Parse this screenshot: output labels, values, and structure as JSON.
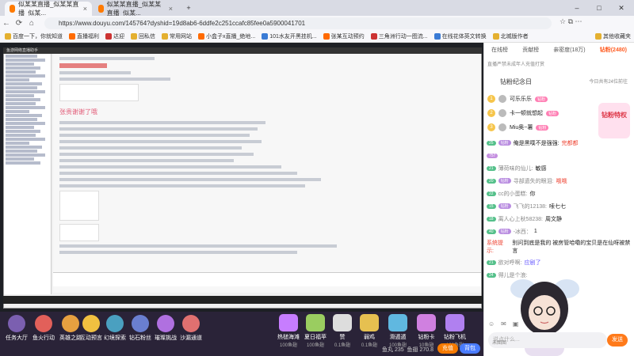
{
  "browser": {
    "tabs": [
      {
        "title": "似某某直播_似某某直播_似某..."
      },
      {
        "title": "似某某直播_似某某直播_似某..."
      }
    ],
    "url": "https://www.douyu.com/145764?dyshid=19d8ab6-6ddfe2c251ccafc85fee0a5900041701",
    "bookmarks": [
      "百度一下，你就知道",
      "直播福利",
      "达迎",
      "回私信",
      "常用网站",
      "小盒子x直播_绝地...",
      "101水友开黑挂机...",
      "张某互动预约",
      "三角洲行动一图流...",
      "在线花体英文转换",
      "北城版作者",
      "其他收藏夹"
    ]
  },
  "video": {
    "doc_heading": "张贵谢谢了哦",
    "screen_title": "鱼游网络直播助手"
  },
  "bottom_bar": {
    "nav_items": [
      "任务大厅",
      "鱼火行动",
      "英雄之路",
      "互动预言",
      "幻境探索",
      "钻石粉丝",
      "璀璨挑战",
      "沙漏通道"
    ],
    "gifts": [
      {
        "name": "热槌海滩",
        "price": "100鱼翅"
      },
      {
        "name": "夏日福苹",
        "price": "100鱼翅"
      },
      {
        "name": "赞",
        "price": "0.1鱼翅"
      },
      {
        "name": "弱鸡",
        "price": "0.1鱼翅"
      },
      {
        "name": "滑遁遁",
        "price": "100鱼翅"
      },
      {
        "name": "钻粉卡",
        "price": "10鱼翅"
      },
      {
        "name": "钻粉飞机",
        "price": "100鱼翅"
      }
    ],
    "fishball_label": "鱼丸 235",
    "fishfin_label": "鱼翅 270.8",
    "charge_label": "充值",
    "bag_label": "背包"
  },
  "right_panel": {
    "tabs": [
      "在线榜",
      "贡献榜",
      "亲密度(18万)",
      "钻粉(2480)"
    ],
    "notice": "直播严禁未成年人充值打赏",
    "rank_title": "钻粉纪念日",
    "rank_more": "今日共有24位前往",
    "rank_rows": [
      {
        "no": "1",
        "name": "可乐乐乐",
        "badge": "钻粉"
      },
      {
        "no": "2",
        "name": "卡一顿就想起",
        "badge": "钻粉"
      },
      {
        "no": "3",
        "name": "Miu奥~薯",
        "badge": "钻粉"
      }
    ],
    "promo": "钻粉特权",
    "chat": [
      {
        "lv": "25",
        "fan": "钻粉",
        "user": "",
        "text": "俺是黑噗不是强强:",
        "highlight": "完都都"
      },
      {
        "lv": "757",
        "fan": "",
        "user": "",
        "text": "",
        "highlight": ""
      },
      {
        "lv": "21",
        "fan": "",
        "user": "薄荷味的仙儿:",
        "text": "敏感",
        "highlight": ""
      },
      {
        "lv": "20",
        "fan": "钻粉",
        "user": "寻部遗失的眼泪:",
        "text": "哦哦",
        "highlight": ""
      },
      {
        "lv": "22",
        "fan": "",
        "user": "cc的小蛋糕:",
        "text": "你",
        "highlight": ""
      },
      {
        "lv": "15",
        "fan": "钻粉",
        "user": "飞飞的12138:",
        "text": "嗦七七",
        "highlight": ""
      },
      {
        "lv": "18",
        "fan": "",
        "user": "离人心上秋58238:",
        "text": "周文静",
        "highlight": ""
      },
      {
        "lv": "40",
        "fan": "钻粉",
        "user": "-冰西：",
        "text": "1",
        "highlight": ""
      },
      {
        "lv": "",
        "fan": "",
        "user": "系统提示:",
        "text": "别问到底是我的 被房管哈嘞的宝贝是在仙呀被禁言",
        "highlight": ""
      },
      {
        "lv": "21",
        "fan": "",
        "user": "欲对呼啊:",
        "text": "应剧了",
        "highlight": ""
      },
      {
        "lv": "24",
        "fan": "",
        "user": "得儿是个浪:",
        "text": "",
        "highlight": ""
      }
    ],
    "input_placeholder": "说点什么...",
    "send_label": "发送",
    "pic_label": "未图图"
  }
}
